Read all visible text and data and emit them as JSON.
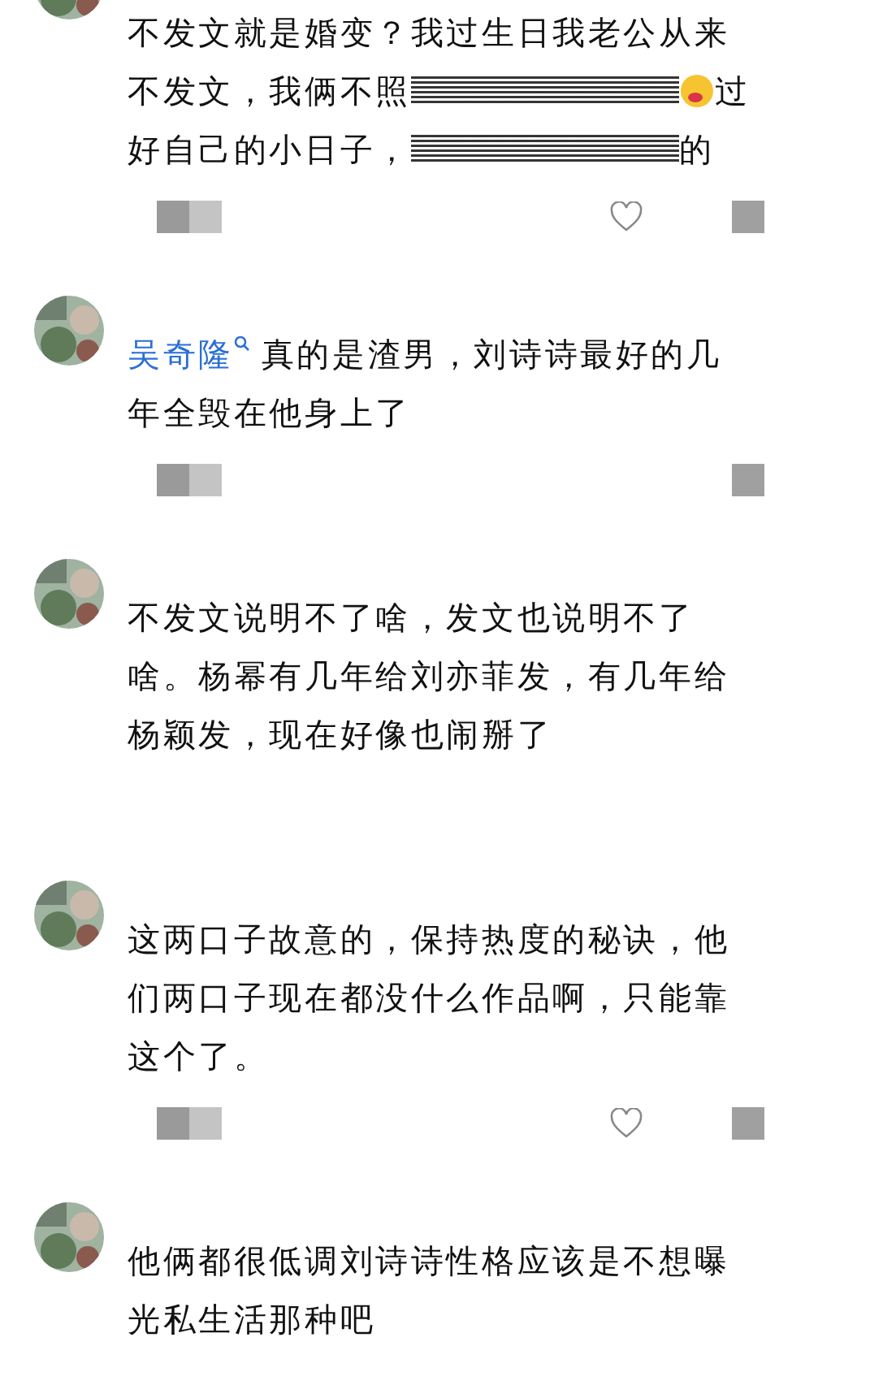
{
  "comments": [
    {
      "lines": [
        [
          {
            "kind": "text",
            "text": "不发文就是婚变？我过生日我老公从来"
          }
        ],
        [
          {
            "kind": "text",
            "text": "不发文，我俩不照"
          },
          {
            "kind": "redaction"
          },
          {
            "kind": "emoji"
          },
          {
            "kind": "text",
            "text": "过"
          }
        ],
        [
          {
            "kind": "text",
            "text": "好自己的小日子，"
          },
          {
            "kind": "redaction"
          },
          {
            "kind": "text",
            "text": "的"
          }
        ]
      ],
      "actions": {
        "heart": true
      }
    },
    {
      "lines": [
        [
          {
            "kind": "mention",
            "text": "吴奇隆"
          },
          {
            "kind": "text",
            "text": "真的是渣男，刘诗诗最好的几"
          }
        ],
        [
          {
            "kind": "text",
            "text": "年全毁在他身上了"
          }
        ]
      ],
      "actions": {
        "heart": false
      }
    },
    {
      "lines": [
        [
          {
            "kind": "text",
            "text": "不发文说明不了啥，发文也说明不了"
          }
        ],
        [
          {
            "kind": "text",
            "text": "啥。杨幂有几年给刘亦菲发，有几年给"
          }
        ],
        [
          {
            "kind": "text",
            "text": "杨颖发，现在好像也闹掰了"
          }
        ]
      ]
    },
    {
      "lines": [
        [
          {
            "kind": "text",
            "text": "这两口子故意的，保持热度的秘诀，他"
          }
        ],
        [
          {
            "kind": "text",
            "text": "们两口子现在都没什么作品啊，只能靠"
          }
        ],
        [
          {
            "kind": "text",
            "text": "这个了。"
          }
        ]
      ],
      "actions": {
        "heart": true
      }
    },
    {
      "lines": [
        [
          {
            "kind": "text",
            "text": "他俩都很低调刘诗诗性格应该是不想曝"
          }
        ],
        [
          {
            "kind": "text",
            "text": "光私生活那种吧"
          }
        ]
      ]
    }
  ]
}
